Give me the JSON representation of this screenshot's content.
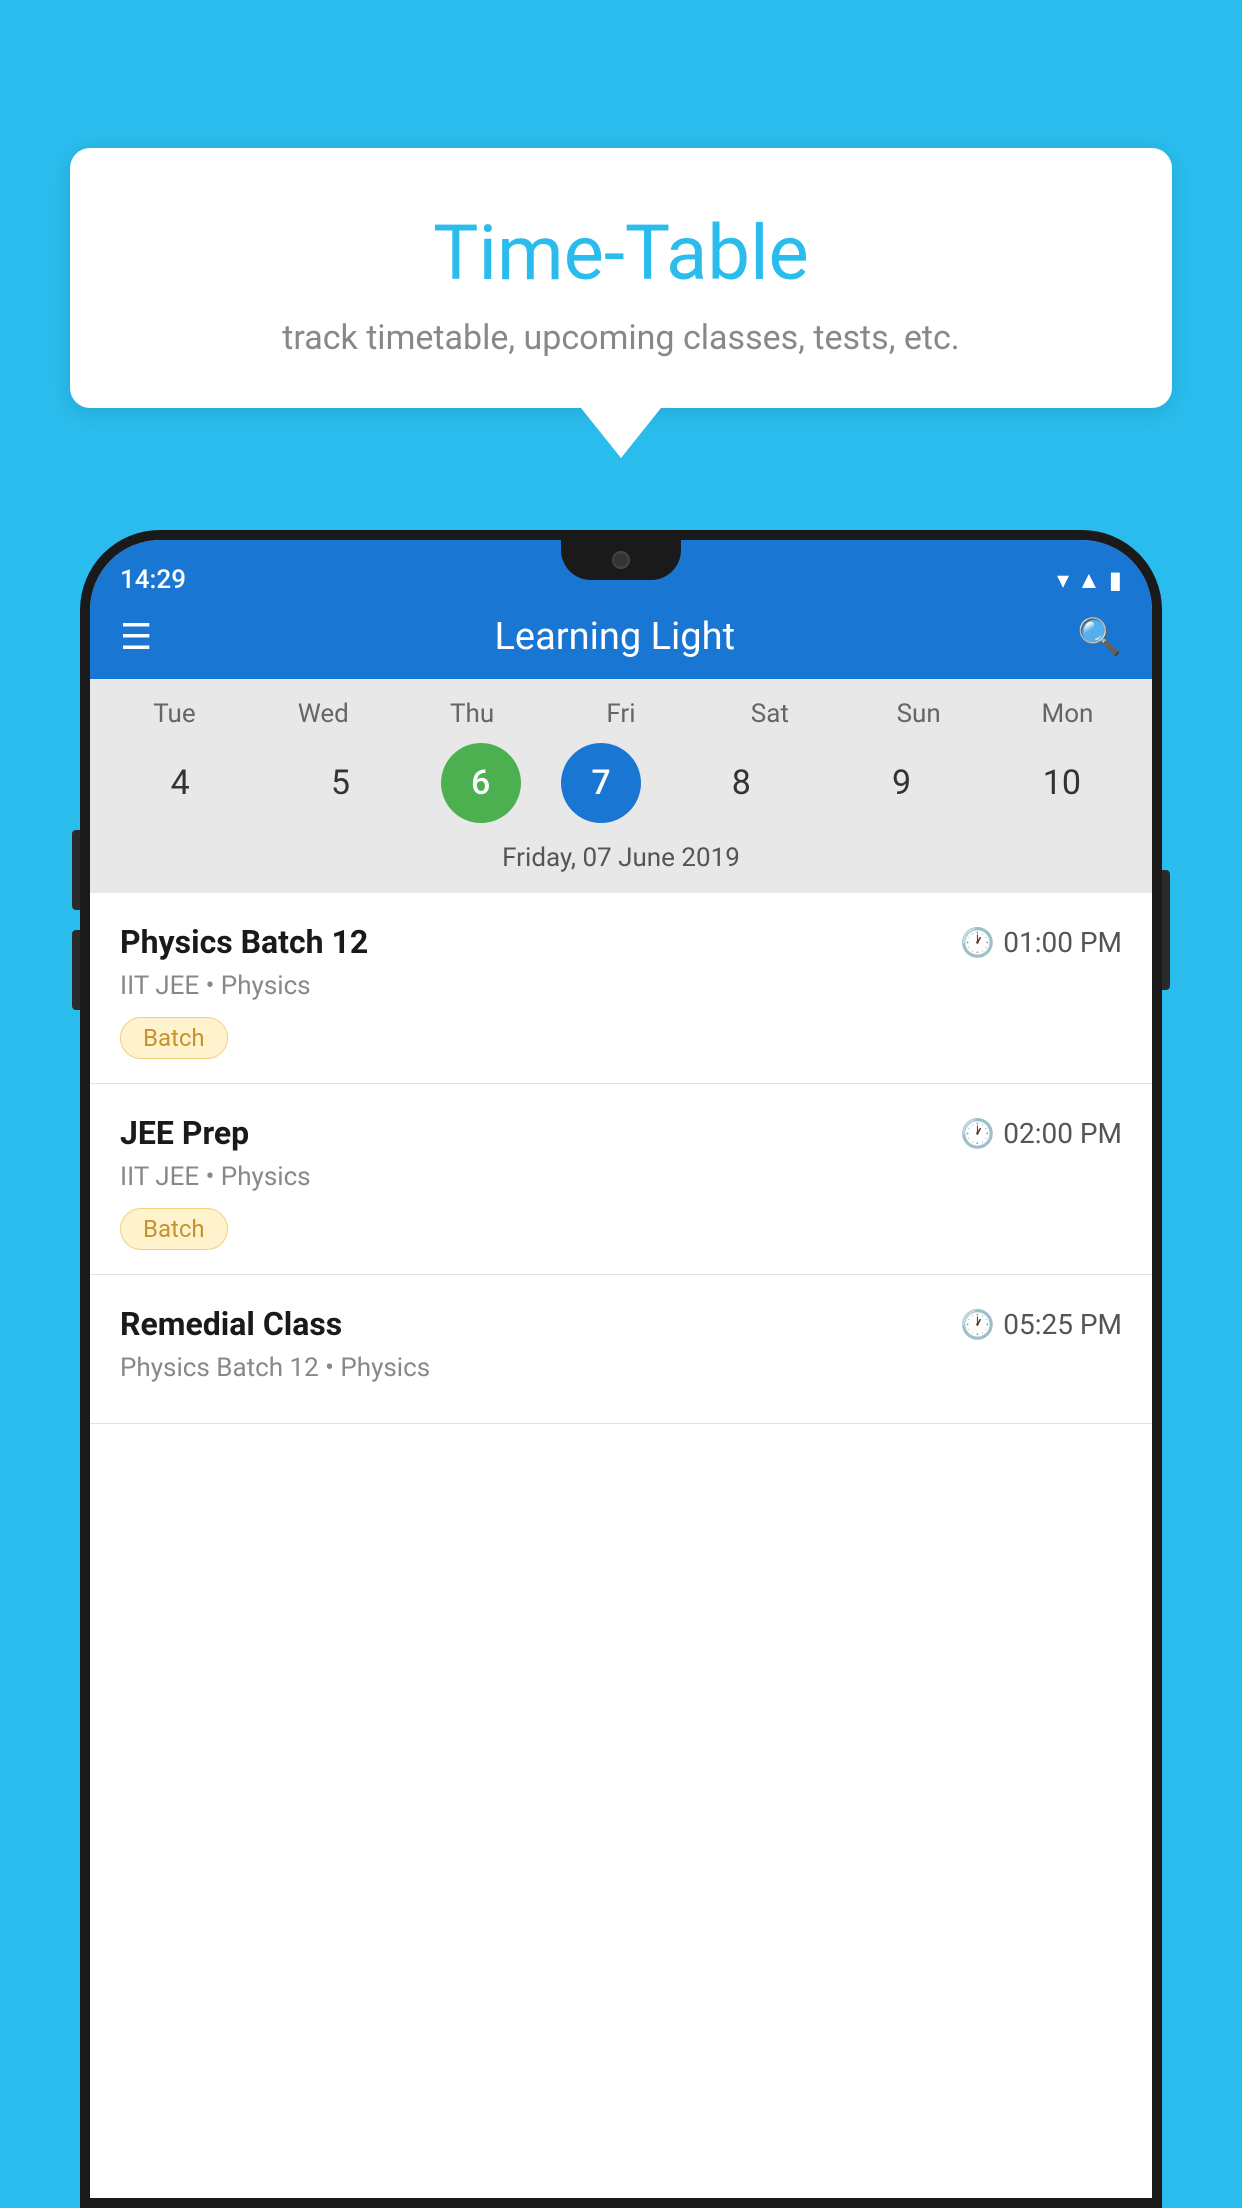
{
  "background_color": "#29BCEC",
  "speech_bubble": {
    "title": "Time-Table",
    "subtitle": "track timetable, upcoming classes, tests, etc."
  },
  "app": {
    "title": "Learning Light",
    "time": "14:29"
  },
  "calendar": {
    "selected_date_label": "Friday, 07 June 2019",
    "days": [
      {
        "name": "Tue",
        "number": "4",
        "state": "normal"
      },
      {
        "name": "Wed",
        "number": "5",
        "state": "normal"
      },
      {
        "name": "Thu",
        "number": "6",
        "state": "today"
      },
      {
        "name": "Fri",
        "number": "7",
        "state": "selected"
      },
      {
        "name": "Sat",
        "number": "8",
        "state": "normal"
      },
      {
        "name": "Sun",
        "number": "9",
        "state": "normal"
      },
      {
        "name": "Mon",
        "number": "10",
        "state": "normal"
      }
    ]
  },
  "schedule": {
    "items": [
      {
        "title": "Physics Batch 12",
        "time": "01:00 PM",
        "subtitle": "IIT JEE • Physics",
        "badge": "Batch"
      },
      {
        "title": "JEE Prep",
        "time": "02:00 PM",
        "subtitle": "IIT JEE • Physics",
        "badge": "Batch"
      },
      {
        "title": "Remedial Class",
        "time": "05:25 PM",
        "subtitle": "Physics Batch 12 • Physics",
        "badge": ""
      }
    ]
  },
  "labels": {
    "menu_icon": "≡",
    "search_icon": "🔍",
    "clock_icon": "🕐"
  }
}
